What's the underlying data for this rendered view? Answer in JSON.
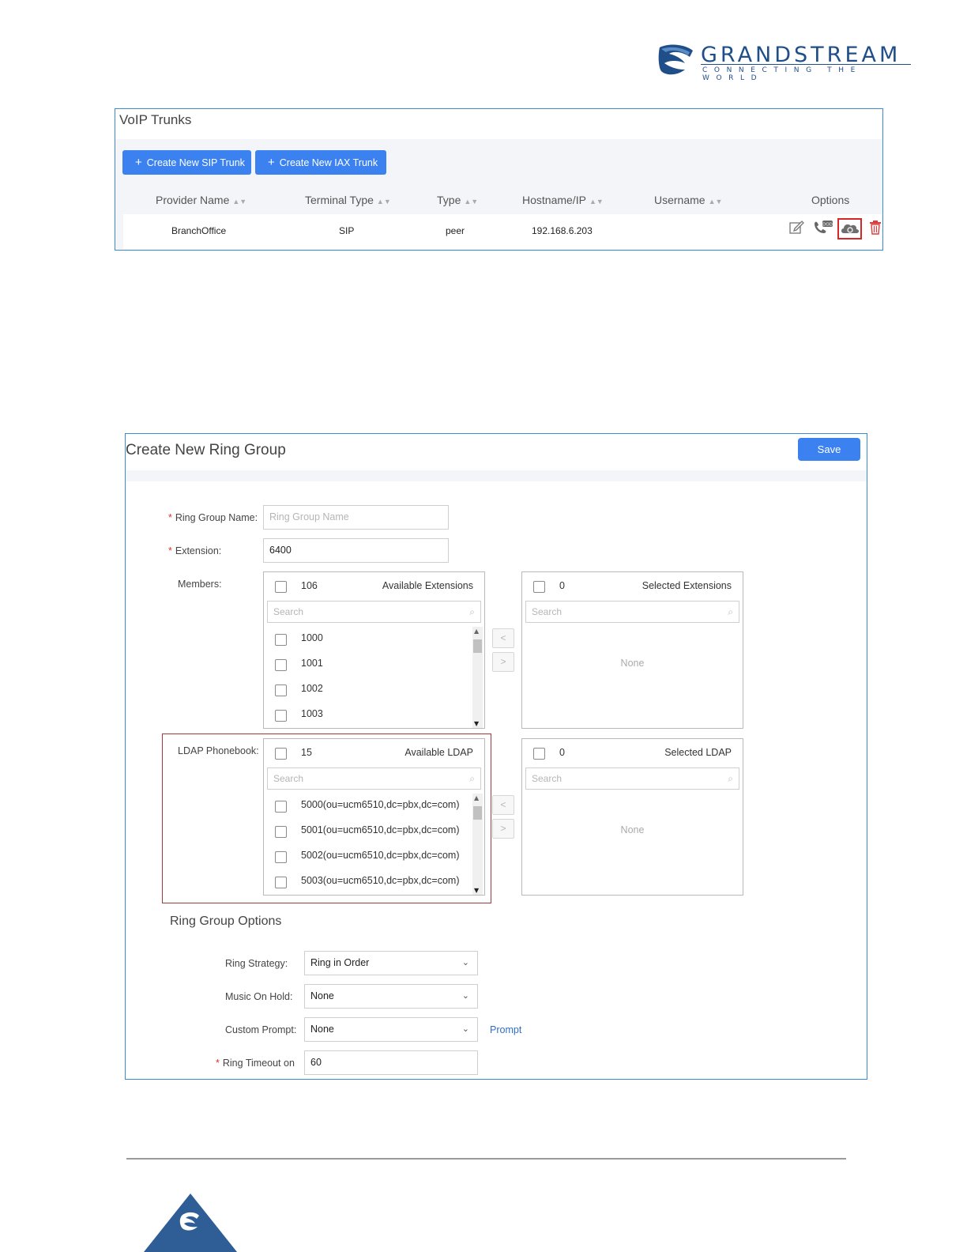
{
  "logo": {
    "name": "GRANDSTREAM",
    "tagline": "CONNECTING THE WORLD"
  },
  "voip": {
    "title": "VoIP Trunks",
    "buttons": {
      "create_sip": "Create New SIP Trunk",
      "create_iax": "Create New IAX Trunk"
    },
    "columns": [
      "Provider Name",
      "Terminal Type",
      "Type",
      "Hostname/IP",
      "Username",
      "Options"
    ],
    "rows": [
      {
        "provider": "BranchOffice",
        "terminal_type": "SIP",
        "type": "peer",
        "hostname": "192.168.6.203",
        "username": ""
      }
    ],
    "options_icons": [
      "edit-icon",
      "did-phone-icon",
      "cloud-sync-icon",
      "delete-icon"
    ]
  },
  "ring": {
    "title": "Create New Ring Group",
    "save": "Save",
    "fields": {
      "name_label": "Ring Group Name",
      "name_placeholder": "Ring Group Name",
      "extension_label": "Extension",
      "extension_value": "6400",
      "members_label": "Members",
      "ldap_label": "LDAP Phonebook"
    },
    "available_ext": {
      "count": "106",
      "title": "Available Extensions",
      "search": "Search",
      "items": [
        "1000",
        "1001",
        "1002",
        "1003"
      ]
    },
    "selected_ext": {
      "count": "0",
      "title": "Selected Extensions",
      "search": "Search",
      "empty": "None"
    },
    "available_ldap": {
      "count": "15",
      "title": "Available LDAP",
      "search": "Search",
      "items": [
        "5000(ou=ucm6510,dc=pbx,dc=com)",
        "5001(ou=ucm6510,dc=pbx,dc=com)",
        "5002(ou=ucm6510,dc=pbx,dc=com)",
        "5003(ou=ucm6510,dc=pbx,dc=com)"
      ]
    },
    "selected_ldap": {
      "count": "0",
      "title": "Selected LDAP",
      "search": "Search",
      "empty": "None"
    },
    "move_left": "<",
    "move_right": ">",
    "options": {
      "heading": "Ring Group Options",
      "ring_strategy_label": "Ring Strategy",
      "ring_strategy_value": "Ring in Order",
      "moh_label": "Music On Hold",
      "moh_value": "None",
      "prompt_label": "Custom Prompt",
      "prompt_value": "None",
      "prompt_link": "Prompt",
      "timeout_label": "Ring Timeout on",
      "timeout_value": "60"
    }
  },
  "colors": {
    "accent": "#3b82f0",
    "panel_border": "#3b8ad8",
    "highlight": "#d62626",
    "brand": "#1f4e89"
  }
}
